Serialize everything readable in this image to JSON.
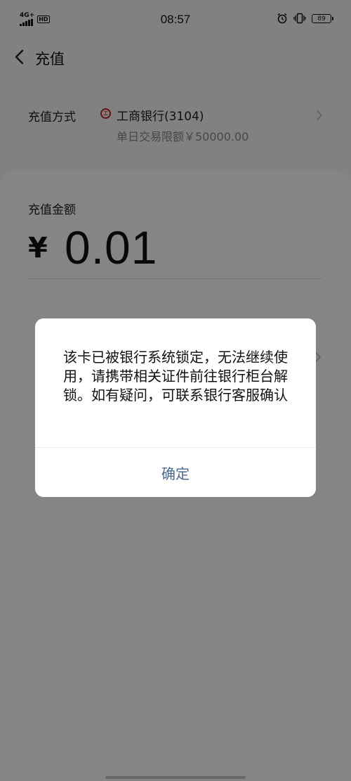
{
  "status_bar": {
    "network": "4G+",
    "hd": "HD",
    "time": "08:57",
    "battery": "89"
  },
  "nav": {
    "title": "充值"
  },
  "recharge_method": {
    "label": "充值方式",
    "bank_name": "工商银行(3104)",
    "daily_limit": "单日交易限额￥50000.00"
  },
  "amount": {
    "label": "充值金额",
    "currency_symbol": "¥",
    "value": "0.01"
  },
  "dialog": {
    "message": "该卡已被银行系统锁定，无法继续使用，请携带相关证件前往银行柜台解锁。如有疑问，可联系银行客服确认",
    "confirm_label": "确定"
  },
  "colors": {
    "bank_brand": "#c6242a",
    "dialog_button": "#4a6894",
    "scrim": "#000000"
  },
  "icons": {
    "back": "chevron-left-icon",
    "row_arrow": "chevron-right-icon",
    "bank": "icbc-logo-icon",
    "alarm": "alarm-icon",
    "vibrate": "vibrate-icon"
  }
}
